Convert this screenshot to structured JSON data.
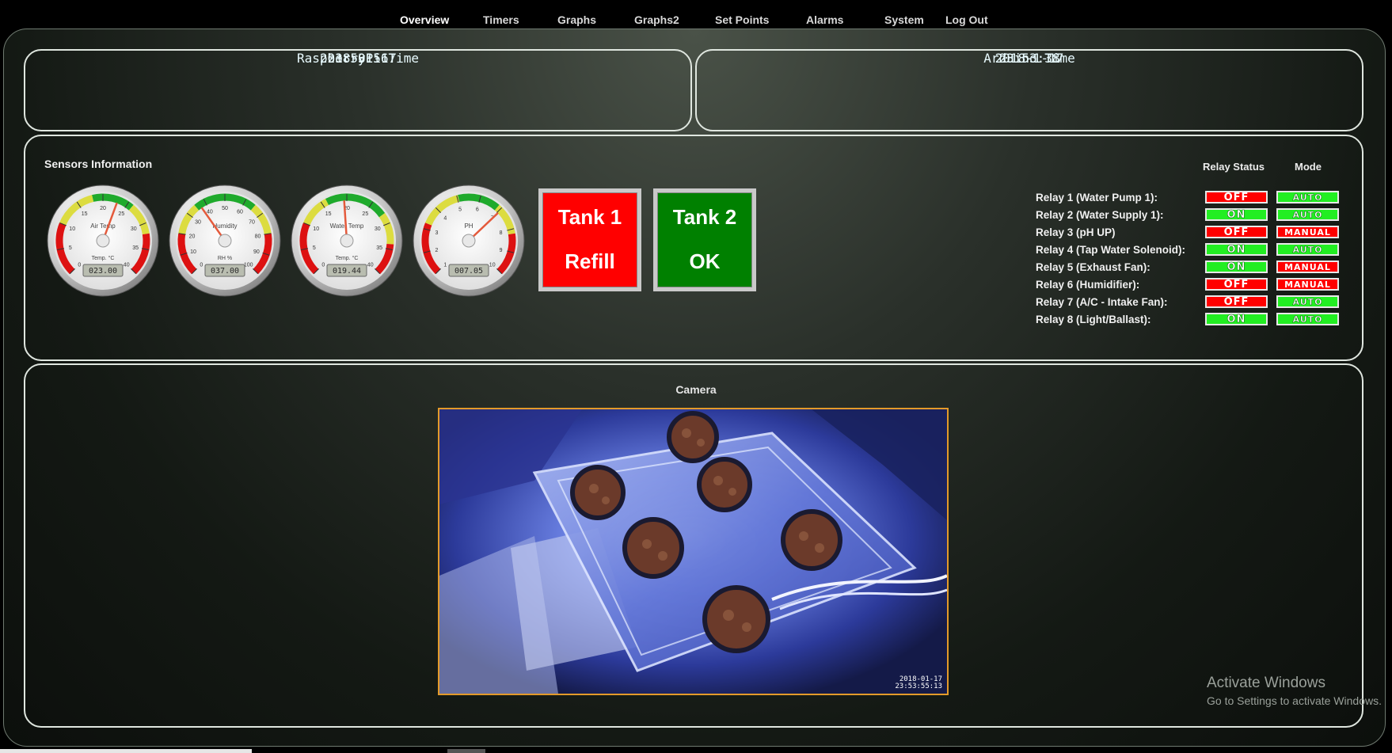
{
  "nav": {
    "items": [
      {
        "label": "Overview",
        "active": true
      },
      {
        "label": "Timers"
      },
      {
        "label": "Graphs"
      },
      {
        "label": "Graphs2"
      },
      {
        "label": "Set Points"
      },
      {
        "label": "Alarms"
      },
      {
        "label": "System"
      },
      {
        "label": "Log Out"
      }
    ]
  },
  "clocks": {
    "pi": {
      "date": "2018-01-17",
      "time": "23:53:56",
      "label": "RaspberryPi Time"
    },
    "arduino": {
      "date": "2018-1-17",
      "time": "23:53:38",
      "label": "Arduino Time"
    }
  },
  "sensors": {
    "title": "Sensors Information",
    "gauges": [
      {
        "title": "Air Temp",
        "unit": "Temp. °C",
        "ticks": [
          "0",
          "5",
          "10",
          "15",
          "20",
          "25",
          "30",
          "35",
          "40"
        ],
        "display": "023.00",
        "value": 23,
        "min": 0,
        "max": 40
      },
      {
        "title": "Humidity",
        "unit": "RH %",
        "ticks": [
          "0",
          "10",
          "20",
          "30",
          "40",
          "50",
          "60",
          "70",
          "80",
          "90",
          "100"
        ],
        "display": "037.00",
        "value": 37,
        "min": 0,
        "max": 100
      },
      {
        "title": "Water Temp",
        "unit": "Temp. °C",
        "ticks": [
          "0",
          "5",
          "10",
          "15",
          "20",
          "25",
          "30",
          "35",
          "40"
        ],
        "display": "019.44",
        "value": 19.44,
        "min": 0,
        "max": 40
      },
      {
        "title": "PH",
        "unit": "",
        "ticks": [
          "1",
          "2",
          "3",
          "4",
          "5",
          "6",
          "7",
          "8",
          "9",
          "10"
        ],
        "display": "007.05",
        "value": 7.05,
        "min": 1,
        "max": 10
      }
    ]
  },
  "tanks": [
    {
      "line1": "Tank 1",
      "line2": "Refill",
      "color": "#ff0000"
    },
    {
      "line1": "Tank 2",
      "line2": "OK",
      "color": "#008000"
    }
  ],
  "relays": {
    "status_header": "Relay Status",
    "mode_header": "Mode",
    "items": [
      {
        "label": "Relay 1 (Water Pump 1):",
        "status": "OFF",
        "mode": "AUTO"
      },
      {
        "label": "Relay 2 (Water Supply 1):",
        "status": "ON",
        "mode": "AUTO"
      },
      {
        "label": "Relay 3 (pH UP)",
        "status": "OFF",
        "mode": "MANUAL"
      },
      {
        "label": "Relay 4 (Tap Water Solenoid):",
        "status": "ON",
        "mode": "AUTO"
      },
      {
        "label": "Relay 5 (Exhaust Fan):",
        "status": "ON",
        "mode": "MANUAL"
      },
      {
        "label": "Relay 6 (Humidifier):",
        "status": "OFF",
        "mode": "MANUAL"
      },
      {
        "label": "Relay 7 (A/C - Intake Fan):",
        "status": "OFF",
        "mode": "AUTO"
      },
      {
        "label": "Relay 8 (Light/Ballast):",
        "status": "ON",
        "mode": "AUTO"
      }
    ]
  },
  "camera": {
    "title": "Camera",
    "stamp_date": "2018-01-17",
    "stamp_time": "23:53:55:13"
  },
  "watermark": {
    "line1": "Activate Windows",
    "line2": "Go to Settings to activate Windows."
  },
  "colors": {
    "off": "#ff0000",
    "on": "#22ee22",
    "accent_clock": "#6fe3ff"
  }
}
